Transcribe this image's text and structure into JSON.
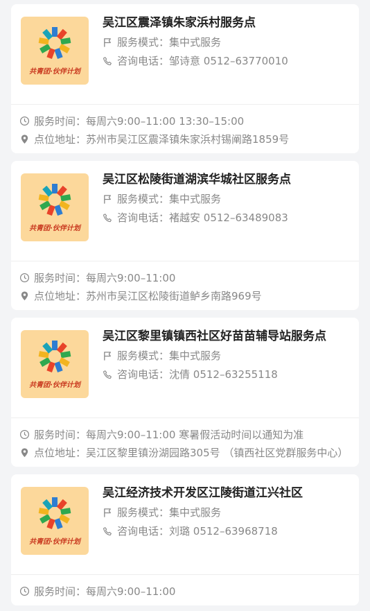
{
  "brand_text": "共青团·伙伴计划",
  "labels": {
    "mode": "服务模式：",
    "phone": "咨询电话：",
    "time": "服务时间：",
    "address": "点位地址："
  },
  "cards": [
    {
      "title": "吴江区震泽镇朱家浜村服务点",
      "mode": "集中式服务",
      "phone": "邹诗意 0512–63770010",
      "time": "每周六9:00–11:00 13:30–15:00",
      "address": "苏州市吴江区震泽镇朱家浜村锡阐路1859号"
    },
    {
      "title": "吴江区松陵街道湖滨华城社区服务点",
      "mode": "集中式服务",
      "phone": "褚越安 0512–63489083",
      "time": "每周六9:00–11:00",
      "address": "苏州市吴江区松陵街道鲈乡南路969号"
    },
    {
      "title": "吴江区黎里镇镇西社区好苗苗辅导站服务点",
      "mode": "集中式服务",
      "phone": "沈倩 0512–63255118",
      "time": "每周六9:00–11:00 寒暑假活动时间以通知为准",
      "address": "吴江区黎里镇汾湖园路305号 （镇西社区党群服务中心）"
    },
    {
      "title": "吴江经济技术开发区江陵街道江兴社区",
      "mode": "集中式服务",
      "phone": "刘璐 0512–63968718",
      "time": "每周六9:00–11:00",
      "address": ""
    }
  ],
  "icons": {
    "mode": "flag-icon",
    "phone": "phone-icon",
    "time": "clock-icon",
    "address": "location-pin-icon"
  }
}
